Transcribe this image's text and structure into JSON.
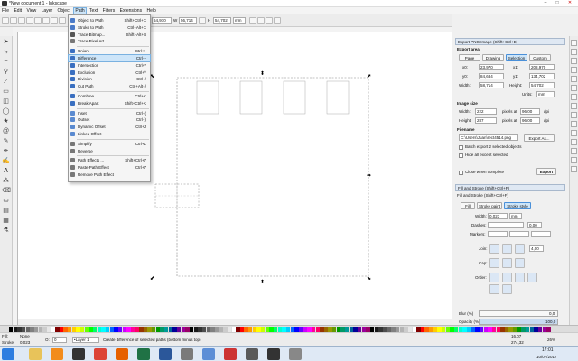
{
  "window": {
    "title": "*New document 1 - Inkscape",
    "min": "–",
    "max": "□",
    "close": "✕"
  },
  "menubar": [
    "File",
    "Edit",
    "View",
    "Layer",
    "Object",
    "Path",
    "Text",
    "Filters",
    "Extensions",
    "Help"
  ],
  "toolbar": {
    "x_label": "X",
    "x_value": "64,970",
    "y_label": "W",
    "y_value": "56,714",
    "h_label": "H",
    "h_value": "54,702",
    "unit": "mm"
  },
  "path_menu": {
    "items": [
      {
        "label": "Object to Path",
        "shortcut": "Shift+Ctrl+C",
        "icon_color": "#4a7ac8"
      },
      {
        "label": "Stroke to Path",
        "shortcut": "Ctrl+Alt+C",
        "icon_color": "#4a7ac8"
      },
      {
        "label": "Trace Bitmap...",
        "shortcut": "Shift+Alt+B",
        "icon_color": "#555555"
      },
      {
        "label": "Trace Pixel Art...",
        "shortcut": "",
        "icon_color": "#777777"
      },
      {
        "label": "Union",
        "shortcut": "Ctrl++",
        "icon_color": "#3a6fc0"
      },
      {
        "label": "Difference",
        "shortcut": "Ctrl+-",
        "icon_color": "#3a6fc0"
      },
      {
        "label": "Intersection",
        "shortcut": "Ctrl+*",
        "icon_color": "#3a6fc0"
      },
      {
        "label": "Exclusion",
        "shortcut": "Ctrl+^",
        "icon_color": "#3a6fc0"
      },
      {
        "label": "Division",
        "shortcut": "Ctrl+/",
        "icon_color": "#3a6fc0"
      },
      {
        "label": "Cut Path",
        "shortcut": "Ctrl+Alt+/",
        "icon_color": "#3a6fc0"
      },
      {
        "label": "Combine",
        "shortcut": "Ctrl+K",
        "icon_color": "#3a6fc0"
      },
      {
        "label": "Break Apart",
        "shortcut": "Shift+Ctrl+K",
        "icon_color": "#3a6fc0"
      },
      {
        "label": "Inset",
        "shortcut": "Ctrl+(",
        "icon_color": "#5a8ad0"
      },
      {
        "label": "Outset",
        "shortcut": "Ctrl+)",
        "icon_color": "#5a8ad0"
      },
      {
        "label": "Dynamic Offset",
        "shortcut": "Ctrl+J",
        "icon_color": "#5a8ad0"
      },
      {
        "label": "Linked Offset",
        "shortcut": "",
        "icon_color": "#5a8ad0"
      },
      {
        "label": "Simplify",
        "shortcut": "Ctrl+L",
        "icon_color": "#777777"
      },
      {
        "label": "Reverse",
        "shortcut": "",
        "icon_color": "#777777"
      },
      {
        "label": "Path Effects ...",
        "shortcut": "Shift+Ctrl+7",
        "icon_color": "#777777"
      },
      {
        "label": "Paste Path Effect",
        "shortcut": "Ctrl+7",
        "icon_color": "#777777"
      },
      {
        "label": "Remove Path Effect",
        "shortcut": "",
        "icon_color": "#777777"
      }
    ]
  },
  "export_panel": {
    "header": "Export PNG Image (Shift+Ctrl+E)",
    "export_area": "Export area",
    "tabs": [
      "Page",
      "Drawing",
      "Selection",
      "Custom"
    ],
    "x0_label": "x0:",
    "x0": "23,970",
    "x1_label": "x1:",
    "x1": "208,970",
    "y0_label": "y0:",
    "y0": "84,684",
    "y1_label": "y1:",
    "y1": "134,702",
    "width_label": "Width:",
    "width": "58,714",
    "height_label": "Height:",
    "height": "54,702",
    "units_label": "Units:",
    "units": "mm",
    "image_size": "Image size",
    "px_width_label": "Width:",
    "px_width": "222",
    "px_height_label": "Height:",
    "px_height": "287",
    "pixels_at": "pixels at",
    "dpi1": "96,00",
    "dpi2": "96,00",
    "dpi_unit": "dpi",
    "filename_label": "Filename",
    "filename": "C:\\Users\\Juan\\rect4514.png",
    "export_as": "Export As...",
    "batch": "Batch export 2 selected objects",
    "hide": "Hide all except selected",
    "close_when": "Close when complete",
    "export_btn": "Export"
  },
  "fill_panel": {
    "header": "Fill and Stroke (Shift+Ctrl+F)",
    "inner_header": "Fill and Stroke (Shift+Ctrl+F)",
    "tabs": [
      "Fill",
      "Stroke paint",
      "Stroke style"
    ],
    "width_label": "Width:",
    "width": "0,023",
    "width_unit": "mm",
    "dashes_label": "Dashes:",
    "dashes_val": "0,00",
    "markers_label": "Markers:",
    "join_label": "Join:",
    "join_val": "4,00",
    "cap_label": "Cap:",
    "order_label": "Order:",
    "blur_label": "Blur (%)",
    "blur_val": "0,0",
    "opacity_label": "Opacity (%)",
    "opacity_val": "100,0"
  },
  "status": {
    "fill_label": "Fill:",
    "fill_val": "None",
    "stroke_label": "Stroke:",
    "stroke_val": "0,023",
    "o_label": "O:",
    "o_val": "0",
    "layer": "•Layer 1",
    "message": "Create difference of selected paths (bottom minus top)",
    "x_coord": "16,07",
    "y_coord": "274,32",
    "zoom": "26%"
  },
  "taskbar": {
    "time": "17:01",
    "date": "10/07/2017",
    "apps": [
      {
        "name": "start",
        "color": "#2d7de0"
      },
      {
        "name": "explorer",
        "color": "#e8c35a"
      },
      {
        "name": "media-player",
        "color": "#f28c1c"
      },
      {
        "name": "inkscape",
        "color": "#333333"
      },
      {
        "name": "chrome",
        "color": "#dc4437"
      },
      {
        "name": "firefox",
        "color": "#e66000"
      },
      {
        "name": "excel",
        "color": "#207245"
      },
      {
        "name": "word",
        "color": "#2b579a"
      },
      {
        "name": "app-9",
        "color": "#7a7a7a"
      },
      {
        "name": "app-10",
        "color": "#5c8ed6"
      },
      {
        "name": "app-11",
        "color": "#cc3333"
      },
      {
        "name": "app-12",
        "color": "#5a5a5a"
      },
      {
        "name": "app-13",
        "color": "#333333"
      },
      {
        "name": "app-14",
        "color": "#888888"
      }
    ]
  }
}
